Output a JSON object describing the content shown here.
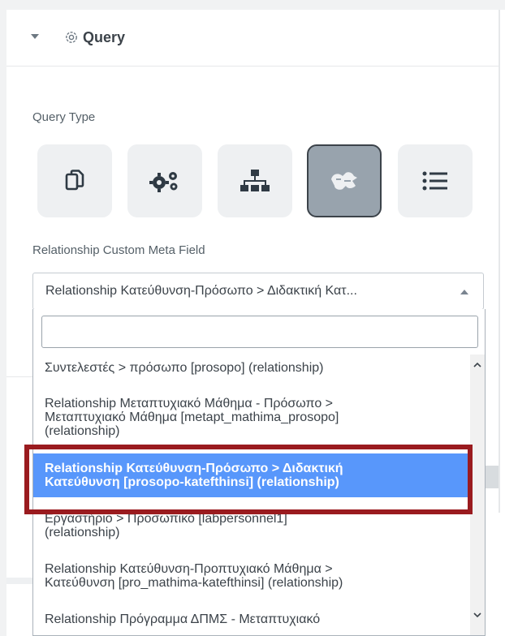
{
  "panel": {
    "title": "Query",
    "icons": {
      "toggle": "caret-down-icon",
      "section": "gear-outline-icon"
    }
  },
  "query_type": {
    "label": "Query Type",
    "buttons": [
      {
        "icon": "copy-icon",
        "active": false
      },
      {
        "icon": "gears-icon",
        "active": false
      },
      {
        "icon": "sitemap-icon",
        "active": false
      },
      {
        "icon": "relationship-icon",
        "active": true
      },
      {
        "icon": "list-icon",
        "active": false
      }
    ]
  },
  "relationship_field": {
    "label": "Relationship Custom Meta Field",
    "selected": "Relationship Κατεύθυνση-Πρόσωπο > Διδακτική Κατ...",
    "search_value": "",
    "options": [
      {
        "lines": [
          "Συντελεστές > πρόσωπο [prosopo] (relationship)"
        ],
        "highlighted": false
      },
      {
        "lines": [
          "Relationship Μεταπτυχιακό Μάθημα - Πρόσωπο >",
          "Μεταπτυχιακό Μάθημα [metapt_mathima_prosopo]",
          "(relationship)"
        ],
        "highlighted": false
      },
      {
        "lines": [
          "Relationship Κατεύθυνση-Πρόσωπο > Διδακτική",
          "Κατεύθυνση [prosopo-katefthinsi] (relationship)"
        ],
        "highlighted": true
      },
      {
        "lines": [
          "Εργαστήριο > Προσωπικό [labpersonnel1]",
          "(relationship)"
        ],
        "highlighted": false
      },
      {
        "lines": [
          "Relationship Κατεύθυνση-Προπτυχιακό Μάθημα >",
          "Κατεύθυνση [pro_mathima-katefthinsi] (relationship)"
        ],
        "highlighted": false
      },
      {
        "lines": [
          "Relationship Πρόγραμμα ΔΠΜΣ - Μεταπτυχιακό"
        ],
        "highlighted": false
      }
    ]
  },
  "colors": {
    "highlight": "#5897fb",
    "annotation": "#9a1b1f",
    "active_button": "#98a3ad",
    "button": "#eef0f2"
  }
}
